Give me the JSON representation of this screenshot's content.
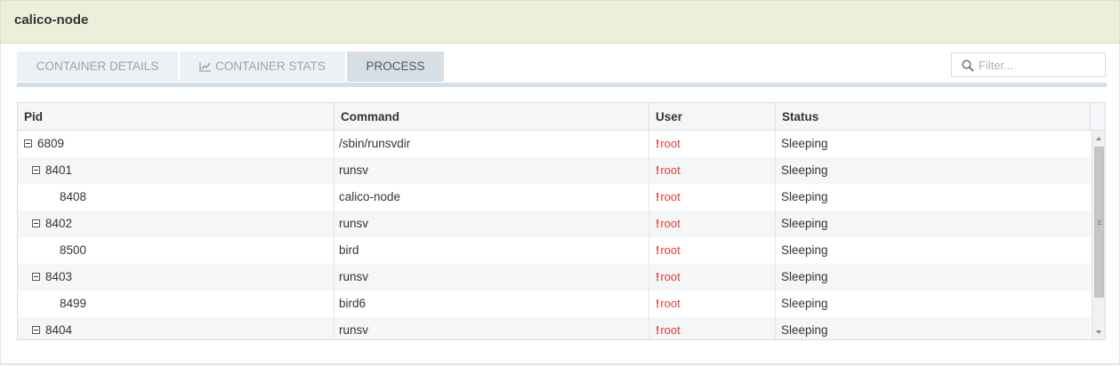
{
  "window": {
    "title": "calico-node"
  },
  "tabs": [
    {
      "label": "CONTAINER DETAILS",
      "icon": "",
      "active": false
    },
    {
      "label": "CONTAINER STATS",
      "icon": "line-chart-icon",
      "active": false
    },
    {
      "label": "PROCESS",
      "icon": "",
      "active": true
    }
  ],
  "filter": {
    "placeholder": "Filter...",
    "value": ""
  },
  "table": {
    "columns": [
      "Pid",
      "Command",
      "User",
      "Status"
    ],
    "rows": [
      {
        "pid": "6809",
        "command": "/sbin/runsvdir",
        "user": "root",
        "status": "Sleeping",
        "level": 0,
        "expandable": true
      },
      {
        "pid": "8401",
        "command": "runsv",
        "user": "root",
        "status": "Sleeping",
        "level": 1,
        "expandable": true
      },
      {
        "pid": "8408",
        "command": "calico-node",
        "user": "root",
        "status": "Sleeping",
        "level": 2,
        "expandable": false
      },
      {
        "pid": "8402",
        "command": "runsv",
        "user": "root",
        "status": "Sleeping",
        "level": 1,
        "expandable": true
      },
      {
        "pid": "8500",
        "command": "bird",
        "user": "root",
        "status": "Sleeping",
        "level": 2,
        "expandable": false
      },
      {
        "pid": "8403",
        "command": "runsv",
        "user": "root",
        "status": "Sleeping",
        "level": 1,
        "expandable": true
      },
      {
        "pid": "8499",
        "command": "bird6",
        "user": "root",
        "status": "Sleeping",
        "level": 2,
        "expandable": false
      },
      {
        "pid": "8404",
        "command": "runsv",
        "user": "root",
        "status": "Sleeping",
        "level": 1,
        "expandable": true
      }
    ],
    "user_warning_mark": "!",
    "user_color": "#e53935"
  },
  "colors": {
    "title_bar": "#ecf0da",
    "tab_active": "#d6dee6",
    "tab_inactive": "#eef1f4"
  }
}
